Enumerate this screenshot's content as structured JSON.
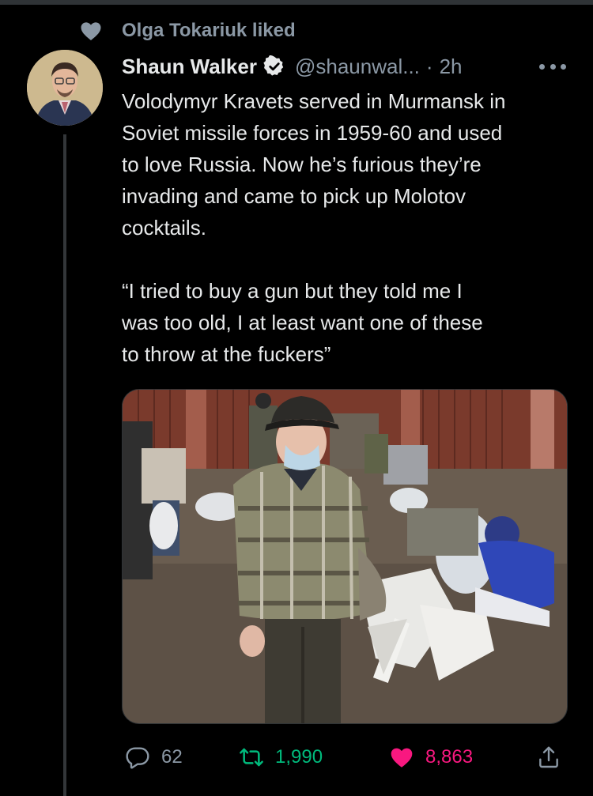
{
  "social_context": {
    "text": "Olga Tokariuk liked"
  },
  "tweet": {
    "author_name": "Shaun Walker",
    "handle": "@shaunwal...",
    "separator": "·",
    "time": "2h",
    "paragraph1": "Volodymyr Kravets served in Murmansk in\nSoviet missile forces in 1959-60 and used\nto love Russia. Now he’s furious they’re\ninvading and came to pick up Molotov\ncocktails.",
    "paragraph2": "“I tried to buy a gun but they told me I\nwas too old, I at least want one of these\nto throw at the fuckers”"
  },
  "actions": {
    "replies": "62",
    "retweets": "1,990",
    "likes": "8,863"
  },
  "icons": {
    "social_context": "heart-icon",
    "verified": "verified-badge-icon",
    "more": "more-options-icon",
    "reply": "reply-icon",
    "retweet": "retweet-icon",
    "like": "heart-icon",
    "share": "share-icon"
  },
  "colors": {
    "background": "#000000",
    "text": "#e7e9ea",
    "secondary": "#8b98a5",
    "retweet": "#00ba7c",
    "like": "#f91880"
  }
}
